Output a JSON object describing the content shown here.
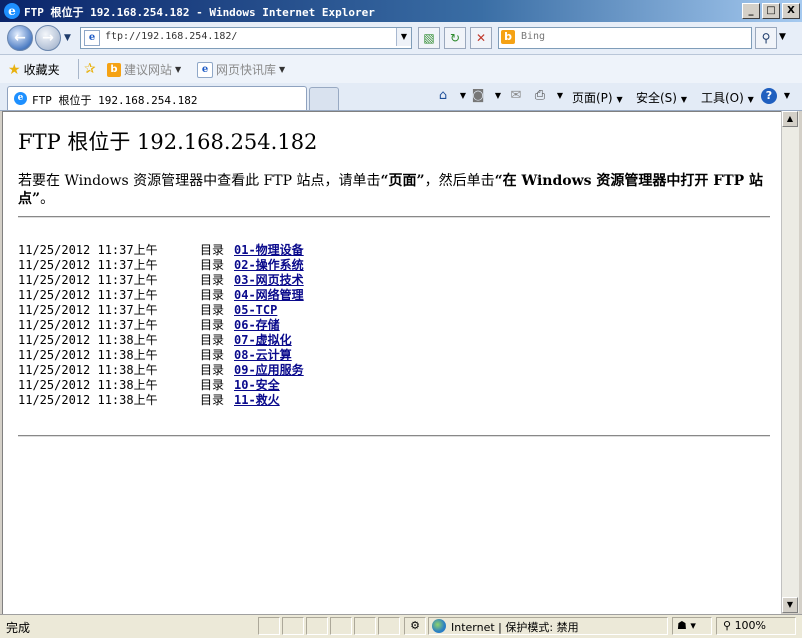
{
  "window": {
    "title": "FTP 根位于 192.168.254.182 - Windows Internet Explorer",
    "controls": {
      "minimize": "_",
      "maximize": "□",
      "close": "X"
    }
  },
  "address_bar": {
    "url": "ftp://192.168.254.182/",
    "search_placeholder": "Bing"
  },
  "favorites_bar": {
    "favorites_label": "收藏夹",
    "items": [
      {
        "label": "建议网站"
      },
      {
        "label": "网页快讯库"
      }
    ]
  },
  "tab": {
    "label": "FTP 根位于 192.168.254.182"
  },
  "command_bar": {
    "page_label": "页面(P)",
    "safety_label": "安全(S)",
    "tools_label": "工具(O)"
  },
  "page": {
    "heading": "FTP 根位于 192.168.254.182",
    "intro_prefix": "若要在 Windows 资源管理器中查看此 FTP 站点，请单击",
    "intro_q1": "“页面”",
    "intro_middle": "，然后单击",
    "intro_q2": "“在 Windows 资源管理器中打开 FTP 站点”",
    "intro_suffix": "。",
    "entries": [
      {
        "timestamp": "11/25/2012 11:37上午",
        "type": "目录",
        "name": "01-物理设备"
      },
      {
        "timestamp": "11/25/2012 11:37上午",
        "type": "目录",
        "name": "02-操作系统"
      },
      {
        "timestamp": "11/25/2012 11:37上午",
        "type": "目录",
        "name": "03-网页技术"
      },
      {
        "timestamp": "11/25/2012 11:37上午",
        "type": "目录",
        "name": "04-网络管理"
      },
      {
        "timestamp": "11/25/2012 11:37上午",
        "type": "目录",
        "name": "05-TCP"
      },
      {
        "timestamp": "11/25/2012 11:37上午",
        "type": "目录",
        "name": "06-存储"
      },
      {
        "timestamp": "11/25/2012 11:38上午",
        "type": "目录",
        "name": "07-虚拟化"
      },
      {
        "timestamp": "11/25/2012 11:38上午",
        "type": "目录",
        "name": "08-云计算"
      },
      {
        "timestamp": "11/25/2012 11:38上午",
        "type": "目录",
        "name": "09-应用服务"
      },
      {
        "timestamp": "11/25/2012 11:38上午",
        "type": "目录",
        "name": "10-安全"
      },
      {
        "timestamp": "11/25/2012 11:38上午",
        "type": "目录",
        "name": "11-救火"
      }
    ]
  },
  "status_bar": {
    "status_text": "完成",
    "zone_text": "Internet | 保护模式: 禁用",
    "zoom_text": "100%"
  }
}
